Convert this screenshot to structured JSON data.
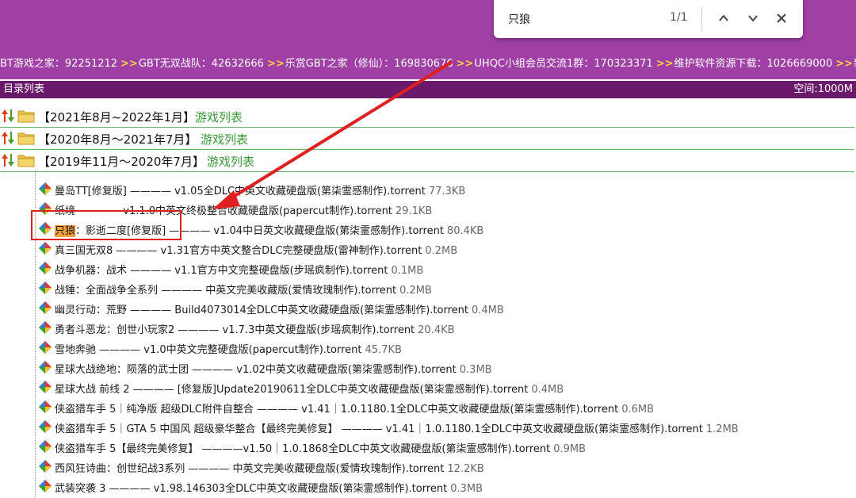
{
  "marquee": [
    {
      "text": "BT游戏之家：92251212"
    },
    {
      "text": "GBT无双战队：42632666"
    },
    {
      "text": "乐赏GBT之家（修仙）：169830676"
    },
    {
      "text": "UHQC小组会员交流1群：170323371"
    },
    {
      "text": "维护软件资源下载：1026669000"
    },
    {
      "text": "新浪微博"
    }
  ],
  "separator": ">>",
  "find_bar": {
    "query": "只狼",
    "count": "1/1"
  },
  "dir_bar": {
    "title": "目录列表",
    "space": "空间:1000M"
  },
  "folders": [
    {
      "name": "【2021年8月~2022年1月】",
      "link": "游戏列表"
    },
    {
      "name": "【2020年8月～2021年7月】",
      "link": "游戏列表"
    },
    {
      "name": "【2019年11月～2020年7月】",
      "link": "游戏列表"
    }
  ],
  "files": [
    {
      "name": "曼岛TT[修复版]",
      "detail": " ———— v1.05全DLC中英文收藏硬盘版(第柒霊感制作).torrent",
      "size": "77.3KB"
    },
    {
      "name": "纸境",
      "detail": " ———— v1.1.0中英文终极整合收藏硬盘版(papercut制作).torrent",
      "size": "29.1KB"
    },
    {
      "name_highlight": "只狼",
      "name": "：影逝二度[修复版]",
      "detail": " ———— v1.04中日英文收藏硬盘版(第柒霊感制作).torrent",
      "size": "80.4KB"
    },
    {
      "name": "真三国无双8",
      "detail": " ———— v1.31官方中英文整合DLC完整硬盘版(雷神制作).torrent",
      "size": "0.2MB"
    },
    {
      "name": "战争机器：战术",
      "detail": " ———— v1.1官方中文完整硬盘版(步瑶疯制作).torrent",
      "size": "0.1MB"
    },
    {
      "name": "战锤：全面战争全系列",
      "detail": " ———— 中英文完美收藏版(爱情玫瑰制作).torrent",
      "size": "0.2MB"
    },
    {
      "name": "幽灵行动：荒野",
      "detail": " ———— Build4073014全DLC中英文收藏硬盘版(第柒霊感制作).torrent",
      "size": "0.4MB"
    },
    {
      "name": "勇者斗恶龙：创世小玩家2",
      "detail": " ———— v1.7.3中英文硬盘版(步瑶疯制作).torrent",
      "size": "20.4KB"
    },
    {
      "name": "雪地奔驰",
      "detail": " ———— v1.0中英文完整硬盘版(papercut制作).torrent",
      "size": "45.7KB"
    },
    {
      "name": "星球大战绝地：陨落的武士团",
      "detail": " ———— v1.02中英文收藏硬盘版(第柒霊感制作).torrent",
      "size": "0.3MB"
    },
    {
      "name": "星球大战 前线 2",
      "detail": " ———— [修复版]Update20190611全DLC中英文收藏硬盘版(第柒霊感制作).torrent",
      "size": "0.4MB"
    },
    {
      "name": "侠盗猎车手 5｜纯净版 超级DLC附件自整合",
      "detail": " ———— v1.41｜1.0.1180.1全DLC中英文收藏硬盘版(第柒霊感制作).torrent",
      "size": "0.6MB"
    },
    {
      "name": "侠盗猎车手 5｜GTA 5 中国风 超级豪华整合【最终完美修复】",
      "detail": " ———— v1.41｜1.0.1180.1全DLC中英文收藏硬盘版(第柒霊感制作).torrent",
      "size": "1.2MB"
    },
    {
      "name": "侠盗猎车手 5【最终完美修复】",
      "detail": " ————v1.50｜1.0.1868全DLC中英文收藏硬盘版(第柒霊感制作).torrent",
      "size": "0.9MB"
    },
    {
      "name": "西风狂诗曲：创世纪战3系列",
      "detail": " ———— 中英文完美收藏硬盘版(爱情玫瑰制作).torrent",
      "size": "12.2KB"
    },
    {
      "name": "武装突袭 3",
      "detail": " ———— v1.98.146303全DLC中英文收藏硬盘版(第柒霊感制作).torrent",
      "size": "0.3MB"
    }
  ],
  "colors": {
    "topbar": "#a040a6",
    "dirbar": "#6b1a6b",
    "folder_link": "#3a9b34",
    "highlight": "#f6a03c",
    "annotation": "#e02020"
  },
  "icons": {
    "sort": "sort-arrows-icon",
    "folder": "folder-icon",
    "file": "torrent-gem-icon",
    "up": "chevron-up-icon",
    "down": "chevron-down-icon",
    "close": "close-icon"
  }
}
